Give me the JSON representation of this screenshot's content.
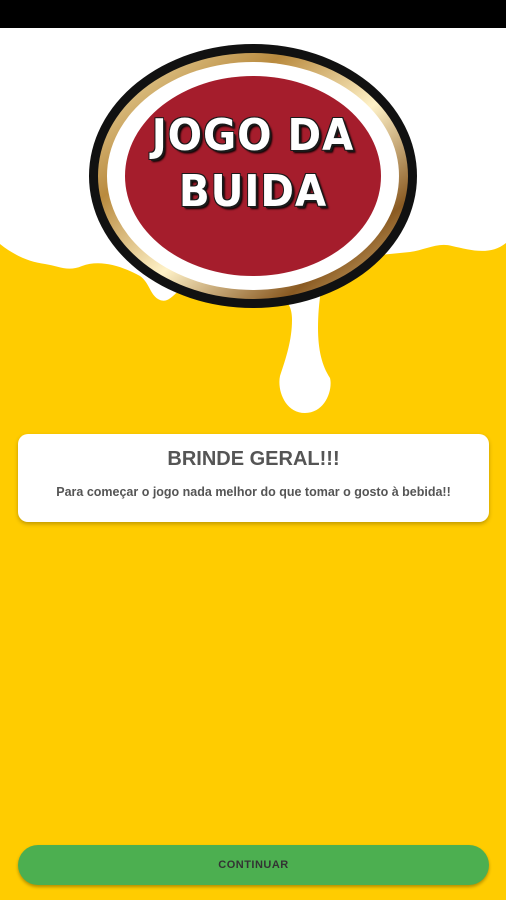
{
  "logo": {
    "line1": "JOGO DA",
    "line2": "BUIDA"
  },
  "card": {
    "title": "BRINDE GERAL!!!",
    "body": "Para começar o jogo nada melhor do que tomar o gosto à bebida!!"
  },
  "footer": {
    "continue_label": "CONTINUAR"
  },
  "colors": {
    "background": "#FFCC00",
    "foam": "#FFFFFF",
    "logo_red": "#A51D2C",
    "button_green": "#4CAF50"
  }
}
